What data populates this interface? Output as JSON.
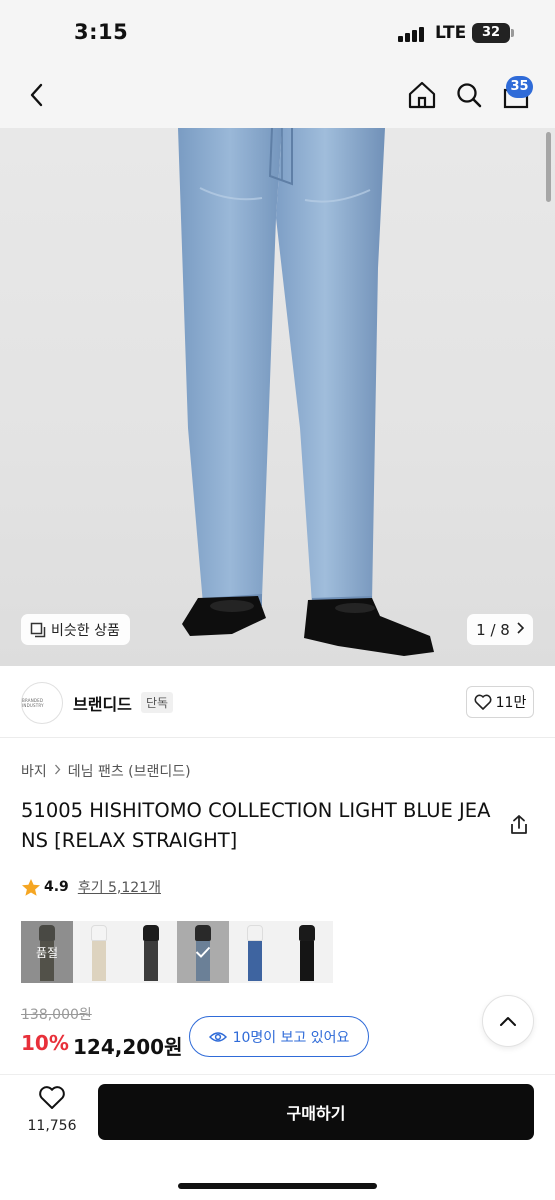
{
  "status": {
    "time": "3:15",
    "network": "LTE",
    "battery": "32"
  },
  "nav": {
    "back_icon": "chevron-left-icon",
    "home_icon": "home-icon",
    "search_icon": "search-icon",
    "cart_icon": "shopping-bag-icon",
    "cart_count": "35"
  },
  "hero": {
    "similar_label": "비슷한 상품",
    "pager": "1 / 8",
    "image_description_colors": {
      "denim": "#8fb0d3",
      "background": "#e5e5e5",
      "shoes": "#0e0e0e"
    }
  },
  "brand": {
    "logo_text": "BRANDED INDUSTRY",
    "name": "브랜디드",
    "tag": "단독",
    "likes": "11만"
  },
  "breadcrumb": {
    "items": [
      "바지",
      "데님 팬츠 (브랜디드)"
    ]
  },
  "product": {
    "title": "51005 HISHITOMO COLLECTION LIGHT BLUE JEANS [RELAX STRAIGHT]",
    "rating": "4.9",
    "reviews": "후기 5,121개",
    "thumbnails": [
      {
        "overlay": "품절",
        "top": "#5a5a4e",
        "bottom": "#6e6a5a"
      },
      {
        "overlay": "",
        "top": "#f4f4f4",
        "bottom": "#ddd3bf"
      },
      {
        "overlay": "",
        "top": "#1c1c1c",
        "bottom": "#3c3c3c"
      },
      {
        "overlay": "selected",
        "top": "#2a2a2a",
        "bottom": "#8fb0d3"
      },
      {
        "overlay": "",
        "top": "#f2f2f2",
        "bottom": "#3e64a0"
      },
      {
        "overlay": "",
        "top": "#1a1a1a",
        "bottom": "#151515"
      }
    ],
    "original_price": "138,000원",
    "discount": "10%",
    "price": "124,200원",
    "viewers": "10명이 보고 있어요"
  },
  "bottom": {
    "wish_count": "11,756",
    "buy_label": "구매하기"
  },
  "colors": {
    "accent_blue": "#2f6bd8",
    "discount_red": "#e8303a",
    "buy_button": "#0c0c0c"
  }
}
